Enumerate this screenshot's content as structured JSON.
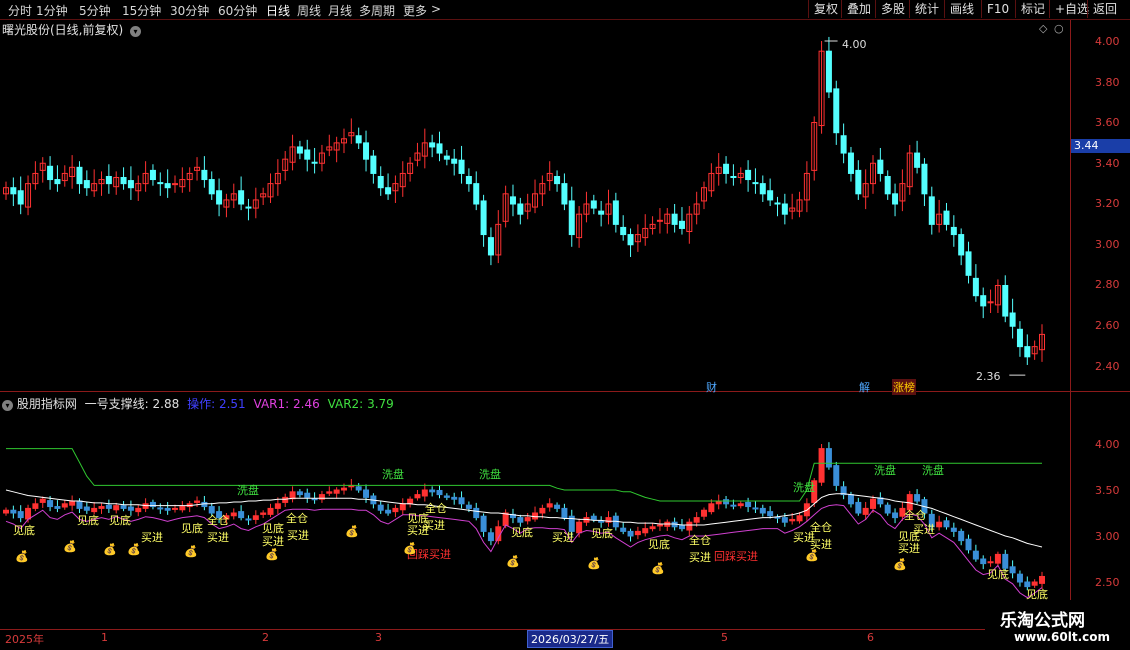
{
  "toolbar": {
    "timeframes": [
      "分时",
      "1分钟",
      "5分钟",
      "15分钟",
      "30分钟",
      "60分钟",
      "日线",
      "周线",
      "月线",
      "多周期",
      "更多"
    ],
    "active": "日线",
    "buttons": [
      "复权",
      "叠加",
      "多股",
      "统计",
      "画线",
      "F10",
      "标记",
      "+自选",
      "返回"
    ]
  },
  "main_title": "曙光股份(日线,前复权)",
  "price_axis": [
    "4.00",
    "3.80",
    "3.60",
    "3.40",
    "3.20",
    "3.00",
    "2.80",
    "2.60",
    "2.40"
  ],
  "current_price": "3.44",
  "high_label": "4.00",
  "low_label": "2.36",
  "events": {
    "cai": "财",
    "jie": "解",
    "zhangbang": "涨榜"
  },
  "indicator": {
    "name": "股朋指标网",
    "line1_label": "一号支撑线:",
    "line1_value": "2.88",
    "op_label": "操作:",
    "op_value": "2.51",
    "var1_label": "VAR1:",
    "var1_value": "2.46",
    "var2_label": "VAR2:",
    "var2_value": "3.79"
  },
  "indicator_axis": [
    "4.00",
    "3.50",
    "3.00",
    "2.50"
  ],
  "signals": {
    "jiandi": "见底",
    "mairu": "买进",
    "quancang": "全仓",
    "xipan": "洗盘",
    "huicai": "回踩买进"
  },
  "x_axis": [
    "2025年",
    "1",
    "2",
    "3",
    "5",
    "6"
  ],
  "date_badge": "2026/03/27/五",
  "watermark": {
    "title": "乐淘公式网",
    "url": "www.60lt.com"
  },
  "colors": {
    "up": "#ff3232",
    "down": "#54ffff",
    "axis": "#8b1a1a",
    "accent": "#1a3ea8"
  },
  "chart_data": {
    "type": "candlestick",
    "ylim": [
      2.3,
      4.05
    ],
    "closes": [
      3.28,
      3.25,
      3.2,
      3.3,
      3.35,
      3.4,
      3.32,
      3.3,
      3.35,
      3.38,
      3.3,
      3.28,
      3.3,
      3.32,
      3.3,
      3.33,
      3.3,
      3.28,
      3.3,
      3.35,
      3.32,
      3.3,
      3.28,
      3.3,
      3.32,
      3.35,
      3.38,
      3.32,
      3.25,
      3.2,
      3.22,
      3.25,
      3.2,
      3.18,
      3.22,
      3.25,
      3.3,
      3.35,
      3.42,
      3.48,
      3.45,
      3.42,
      3.4,
      3.45,
      3.48,
      3.5,
      3.52,
      3.55,
      3.5,
      3.42,
      3.35,
      3.28,
      3.25,
      3.3,
      3.35,
      3.4,
      3.45,
      3.5,
      3.48,
      3.45,
      3.42,
      3.4,
      3.35,
      3.3,
      3.2,
      3.05,
      2.95,
      3.1,
      3.25,
      3.2,
      3.15,
      3.2,
      3.25,
      3.3,
      3.35,
      3.3,
      3.2,
      3.05,
      3.15,
      3.2,
      3.18,
      3.15,
      3.2,
      3.1,
      3.05,
      3.0,
      3.05,
      3.08,
      3.1,
      3.12,
      3.15,
      3.1,
      3.08,
      3.15,
      3.2,
      3.28,
      3.35,
      3.38,
      3.35,
      3.33,
      3.35,
      3.32,
      3.3,
      3.25,
      3.22,
      3.2,
      3.15,
      3.18,
      3.22,
      3.35,
      3.6,
      3.95,
      3.75,
      3.55,
      3.45,
      3.35,
      3.25,
      3.3,
      3.4,
      3.35,
      3.25,
      3.2,
      3.3,
      3.45,
      3.38,
      3.25,
      3.1,
      3.15,
      3.1,
      3.05,
      2.95,
      2.85,
      2.75,
      2.7,
      2.72,
      2.8,
      2.65,
      2.6,
      2.5,
      2.45,
      2.5,
      2.56
    ],
    "indicator_ylim": [
      2.35,
      4.05
    ],
    "var2_line": [
      3.95,
      3.95,
      3.95,
      3.95,
      3.95,
      3.95,
      3.95,
      3.95,
      3.95,
      3.95,
      3.8,
      3.65,
      3.55,
      3.55,
      3.55,
      3.55,
      3.55,
      3.55,
      3.55,
      3.55,
      3.55,
      3.55,
      3.55,
      3.55,
      3.55,
      3.55,
      3.55,
      3.55,
      3.55,
      3.55,
      3.55,
      3.55,
      3.55,
      3.55,
      3.55,
      3.55,
      3.55,
      3.55,
      3.55,
      3.55,
      3.55,
      3.55,
      3.55,
      3.55,
      3.55,
      3.55,
      3.55,
      3.55,
      3.55,
      3.55,
      3.55,
      3.55,
      3.55,
      3.55,
      3.55,
      3.55,
      3.55,
      3.55,
      3.55,
      3.55,
      3.55,
      3.55,
      3.55,
      3.55,
      3.55,
      3.55,
      3.55,
      3.55,
      3.55,
      3.55,
      3.55,
      3.55,
      3.55,
      3.55,
      3.55,
      3.52,
      3.5,
      3.5,
      3.5,
      3.5,
      3.5,
      3.5,
      3.5,
      3.5,
      3.48,
      3.48,
      3.45,
      3.42,
      3.4,
      3.38,
      3.38,
      3.38,
      3.38,
      3.38,
      3.38,
      3.38,
      3.38,
      3.38,
      3.38,
      3.38,
      3.38,
      3.38,
      3.38,
      3.38,
      3.38,
      3.38,
      3.38,
      3.38,
      3.38,
      3.5,
      3.79,
      3.79,
      3.79,
      3.79,
      3.79,
      3.79,
      3.79,
      3.79,
      3.79,
      3.79,
      3.79,
      3.79,
      3.79,
      3.79,
      3.79,
      3.79,
      3.79,
      3.79,
      3.79,
      3.79,
      3.79,
      3.79,
      3.79,
      3.79,
      3.79,
      3.79,
      3.79,
      3.79,
      3.79,
      3.79,
      3.79,
      3.79
    ],
    "support_line": [
      3.5,
      3.48,
      3.46,
      3.44,
      3.43,
      3.42,
      3.41,
      3.4,
      3.39,
      3.38,
      3.38,
      3.37,
      3.36,
      3.36,
      3.35,
      3.35,
      3.34,
      3.34,
      3.34,
      3.33,
      3.33,
      3.33,
      3.33,
      3.33,
      3.33,
      3.33,
      3.34,
      3.35,
      3.35,
      3.36,
      3.36,
      3.37,
      3.37,
      3.38,
      3.38,
      3.39,
      3.39,
      3.4,
      3.4,
      3.41,
      3.41,
      3.41,
      3.41,
      3.41,
      3.41,
      3.41,
      3.41,
      3.41,
      3.4,
      3.4,
      3.39,
      3.38,
      3.37,
      3.36,
      3.35,
      3.35,
      3.34,
      3.34,
      3.33,
      3.32,
      3.31,
      3.3,
      3.29,
      3.28,
      3.27,
      3.26,
      3.25,
      3.25,
      3.24,
      3.23,
      3.22,
      3.22,
      3.21,
      3.21,
      3.2,
      3.2,
      3.19,
      3.19,
      3.18,
      3.18,
      3.17,
      3.17,
      3.16,
      3.16,
      3.15,
      3.15,
      3.14,
      3.14,
      3.14,
      3.13,
      3.13,
      3.13,
      3.12,
      3.12,
      3.12,
      3.12,
      3.13,
      3.14,
      3.15,
      3.16,
      3.17,
      3.18,
      3.19,
      3.2,
      3.2,
      3.21,
      3.22,
      3.23,
      3.25,
      3.28,
      3.35,
      3.42,
      3.45,
      3.46,
      3.46,
      3.45,
      3.44,
      3.43,
      3.42,
      3.41,
      3.4,
      3.38,
      3.37,
      3.36,
      3.34,
      3.32,
      3.3,
      3.27,
      3.24,
      3.21,
      3.18,
      3.15,
      3.12,
      3.09,
      3.06,
      3.03,
      3.0,
      2.98,
      2.95,
      2.92,
      2.9,
      2.88
    ]
  }
}
